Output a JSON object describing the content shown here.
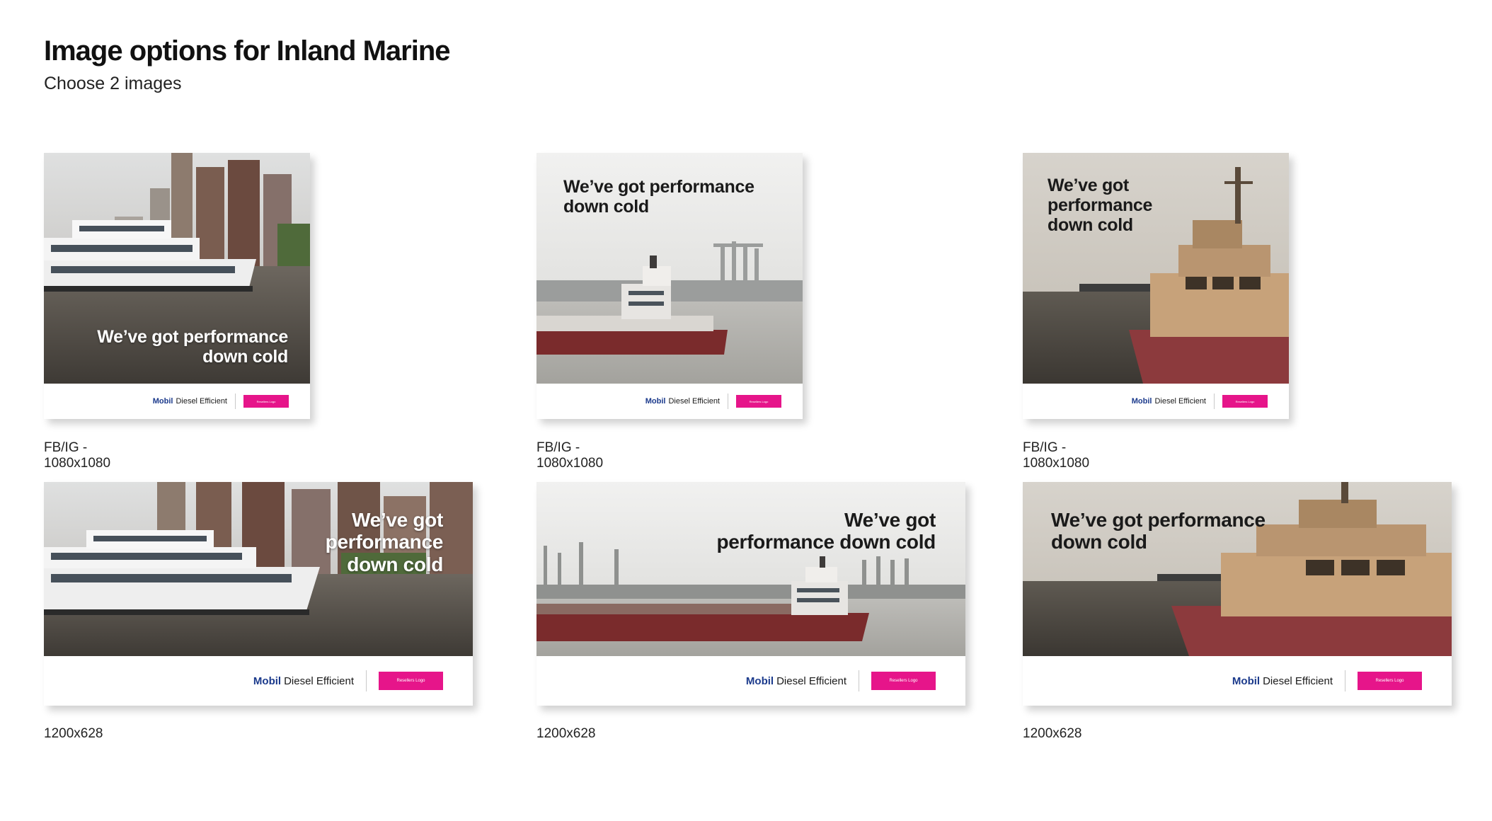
{
  "page": {
    "title": "Image options for Inland Marine",
    "subtitle": "Choose 2 images"
  },
  "colors": {
    "accent_pink": "#e6158a",
    "brand_blue": "#1b3a8c",
    "text_dark": "#111111"
  },
  "ads": [
    {
      "caption": "FB/IG - 1080x1080",
      "headline": "We’ve got performance\ndown cold",
      "brand": "Mobil",
      "brand_sub": "Diesel Efficient",
      "reseller": "Resellers Logo",
      "scene": "ferry-icon"
    },
    {
      "caption": "FB/IG - 1080x1080",
      "headline": "We’ve got performance\ndown cold",
      "brand": "Mobil",
      "brand_sub": "Diesel Efficient",
      "reseller": "Resellers Logo",
      "scene": "tanker-icon"
    },
    {
      "caption": "FB/IG - 1080x1080",
      "headline": "We’ve got\nperformance\ndown cold",
      "brand": "Mobil",
      "brand_sub": "Diesel Efficient",
      "reseller": "Resellers Logo",
      "scene": "tugboat-icon"
    },
    {
      "caption": "1200x628",
      "headline": "We’ve got\nperformance\ndown cold",
      "brand": "Mobil",
      "brand_sub": "Diesel Efficient",
      "reseller": "Resellers Logo",
      "scene": "ferry-icon"
    },
    {
      "caption": "1200x628",
      "headline": "We’ve got\nperformance down cold",
      "brand": "Mobil",
      "brand_sub": "Diesel Efficient",
      "reseller": "Resellers Logo",
      "scene": "tanker-icon"
    },
    {
      "caption": "1200x628",
      "headline": "We’ve got performance\ndown cold",
      "brand": "Mobil",
      "brand_sub": "Diesel Efficient",
      "reseller": "Resellers Logo",
      "scene": "tugboat-icon"
    }
  ]
}
